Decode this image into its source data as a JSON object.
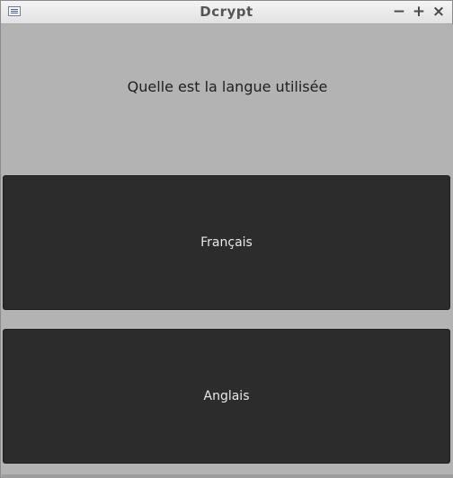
{
  "window": {
    "title": "Dcrypt",
    "controls": {
      "minimize": "−",
      "maximize": "+",
      "close": "×"
    }
  },
  "main": {
    "question": "Quelle est la langue utilisée",
    "options": [
      {
        "label": "Français"
      },
      {
        "label": "Anglais"
      }
    ]
  },
  "colors": {
    "background": "#b3b3b3",
    "button": "#2c2c2c",
    "button_text": "#e8e8e8"
  }
}
